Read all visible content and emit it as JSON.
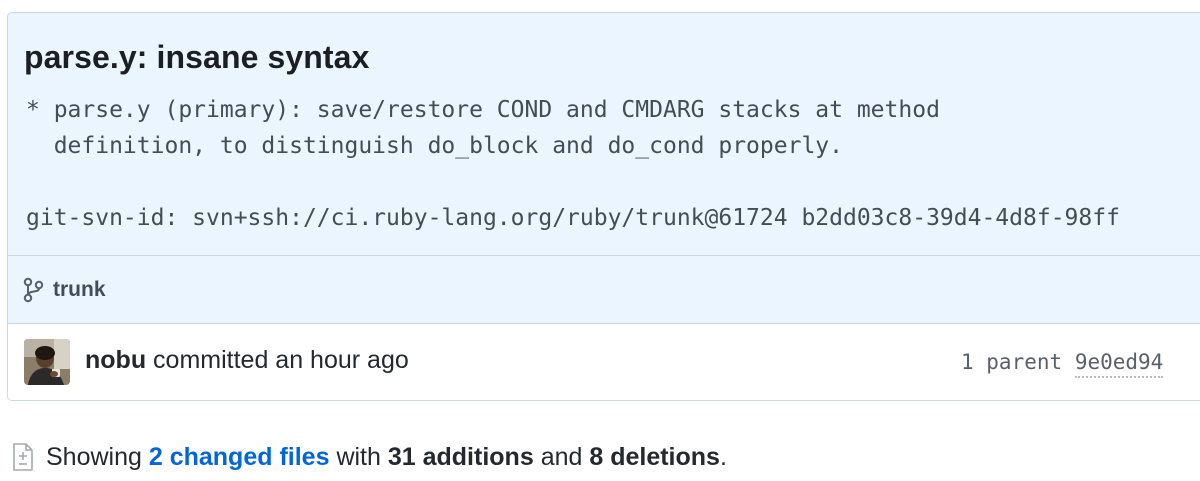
{
  "commit": {
    "title": "parse.y: insane syntax",
    "description": "* parse.y (primary): save/restore COND and CMDARG stacks at method\n  definition, to distinguish do_block and do_cond properly.\n\ngit-svn-id: svn+ssh://ci.ruby-lang.org/ruby/trunk@61724 b2dd03c8-39d4-4d8f-98ff",
    "branch": "trunk",
    "author": "nobu",
    "committed_text": "committed an hour ago",
    "parent_label": "1 parent",
    "parent_sha": "9e0ed94"
  },
  "summary": {
    "showing": "Showing",
    "changed_files": "2 changed files",
    "with": "with",
    "additions": "31 additions",
    "and": "and",
    "deletions": "8 deletions",
    "period": "."
  },
  "icons": {
    "branch": "git-branch-icon",
    "diff": "file-diff-icon"
  },
  "colors": {
    "header_bg": "#eaf5ff",
    "link": "#0366d6",
    "border": "#c9d7e6"
  }
}
